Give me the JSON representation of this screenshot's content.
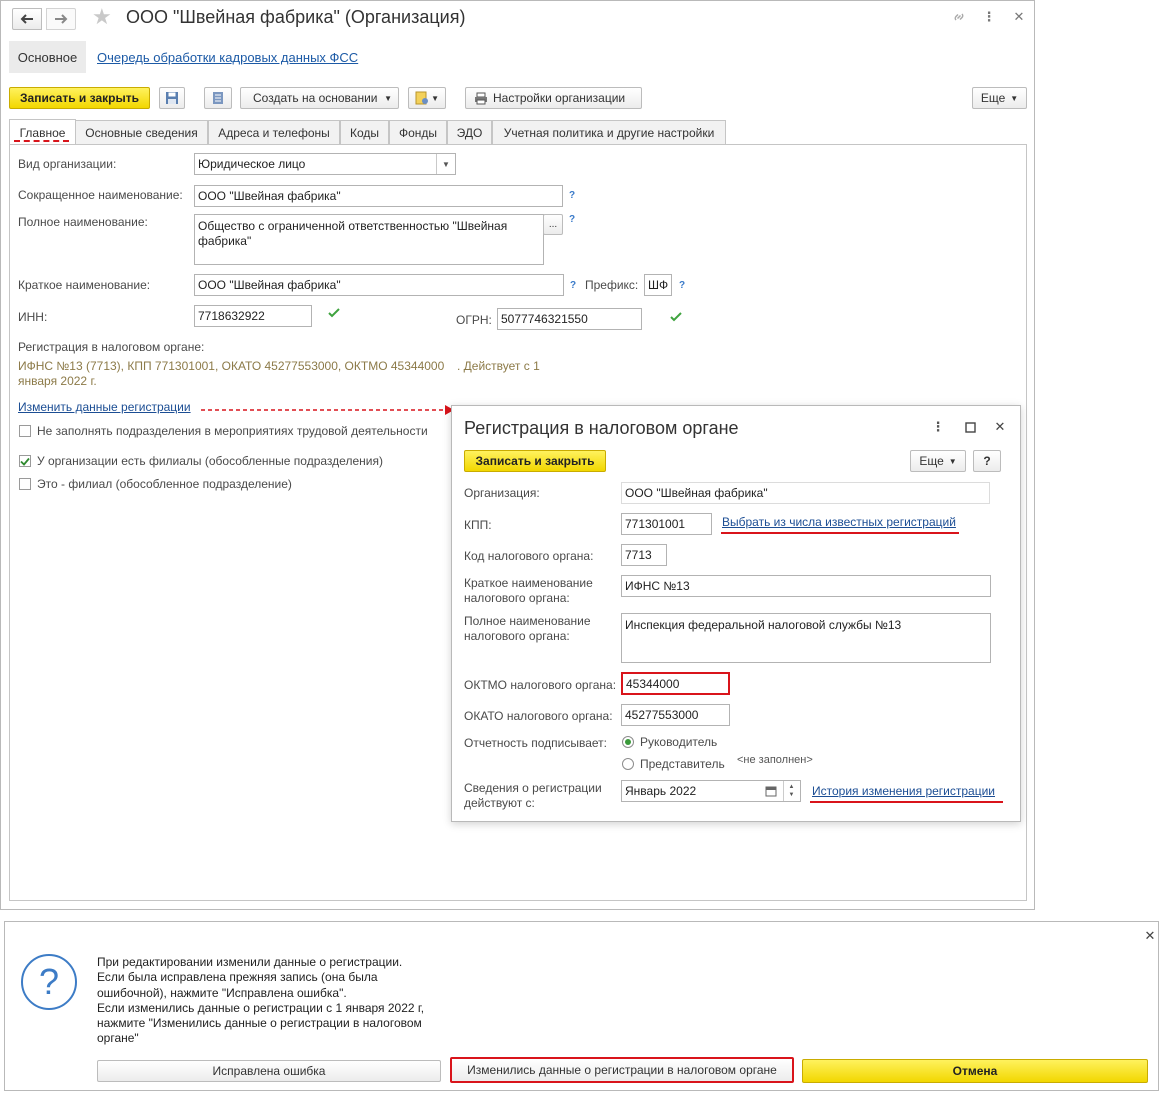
{
  "main": {
    "title": "ООО \"Швейная фабрика\" (Организация)",
    "nav": {
      "basic": "Основное",
      "queue_link": "Очередь обработки кадровых данных ФСС"
    },
    "toolbar": {
      "save_close": "Записать и закрыть",
      "create_based": "Создать на основании",
      "org_settings": "Настройки организации",
      "more": "Еще"
    },
    "tabs": [
      "Главное",
      "Основные сведения",
      "Адреса и телефоны",
      "Коды",
      "Фонды",
      "ЭДО",
      "Учетная политика и другие настройки"
    ],
    "form": {
      "org_type_label": "Вид организации:",
      "org_type_value": "Юридическое лицо",
      "short_name_label": "Сокращенное наименование:",
      "short_name_value": "ООО \"Швейная фабрика\"",
      "full_name_label": "Полное наименование:",
      "full_name_value": "Общество с ограниченной ответственностью \"Швейная фабрика\"",
      "brief_name_label": "Краткое наименование:",
      "brief_name_value": "ООО \"Швейная фабрика\"",
      "prefix_label": "Префикс:",
      "prefix_value": "ШФ",
      "inn_label": "ИНН:",
      "inn_value": "7718632922",
      "ogrn_label": "ОГРН:",
      "ogrn_value": "5077746321550",
      "tax_reg_label": "Регистрация в налоговом органе:",
      "tax_reg_line1": "ИФНС №13 (7713), КПП 771301001, ОКАТО 45277553000, ОКТМО 45344000",
      "tax_reg_line1_b": ". Действует с 1",
      "tax_reg_line2": "января 2022 г.",
      "change_reg_link": "Изменить данные регистрации",
      "cb_no_fill": "Не заполнять подразделения в мероприятиях трудовой деятельности",
      "cb_branches": "У организации есть филиалы (обособленные подразделения)",
      "cb_is_branch": "Это - филиал (обособленное подразделение)",
      "help_mark": "?"
    }
  },
  "dialog": {
    "title": "Регистрация в налоговом органе",
    "save_close": "Записать и закрыть",
    "more": "Еще",
    "help": "?",
    "org_label": "Организация:",
    "org_value": "ООО \"Швейная фабрика\"",
    "kpp_label": "КПП:",
    "kpp_value": "771301001",
    "pick_link": "Выбрать из числа известных регистраций",
    "code_label": "Код налогового органа:",
    "code_value": "7713",
    "short_label_1": "Краткое наименование",
    "short_label_2": "налогового органа:",
    "short_value": "ИФНС №13",
    "full_label_1": "Полное наименование",
    "full_label_2": "налогового органа:",
    "full_value": "Инспекция федеральной налоговой службы №13",
    "oktmo_label": "ОКТМО налогового органа:",
    "oktmo_value": "45344000",
    "okato_label": "ОКАТО налогового органа:",
    "okato_value": "45277553000",
    "signer_label": "Отчетность подписывает:",
    "signer_head": "Руководитель",
    "signer_rep": "Представитель",
    "not_filled": "<не заполнен>",
    "since_label_1": "Сведения о регистрации",
    "since_label_2": "действуют с:",
    "since_value": "Январь 2022",
    "history_link": "История изменения регистрации"
  },
  "prompt": {
    "line1": "При редактировании изменили данные о регистрации.",
    "line2": "Если была исправлена прежняя запись (она была",
    "line3": "ошибочной), нажмите \"Исправлена ошибка\".",
    "line4": "Если изменились данные о регистрации с 1 января 2022 г,",
    "line5": "нажмите \"Изменились данные о регистрации в налоговом",
    "line6": "органе\"",
    "btn_fixed": "Исправлена ошибка",
    "btn_changed": "Изменились данные о регистрации в налоговом органе",
    "btn_cancel": "Отмена",
    "question_mark": "?"
  }
}
